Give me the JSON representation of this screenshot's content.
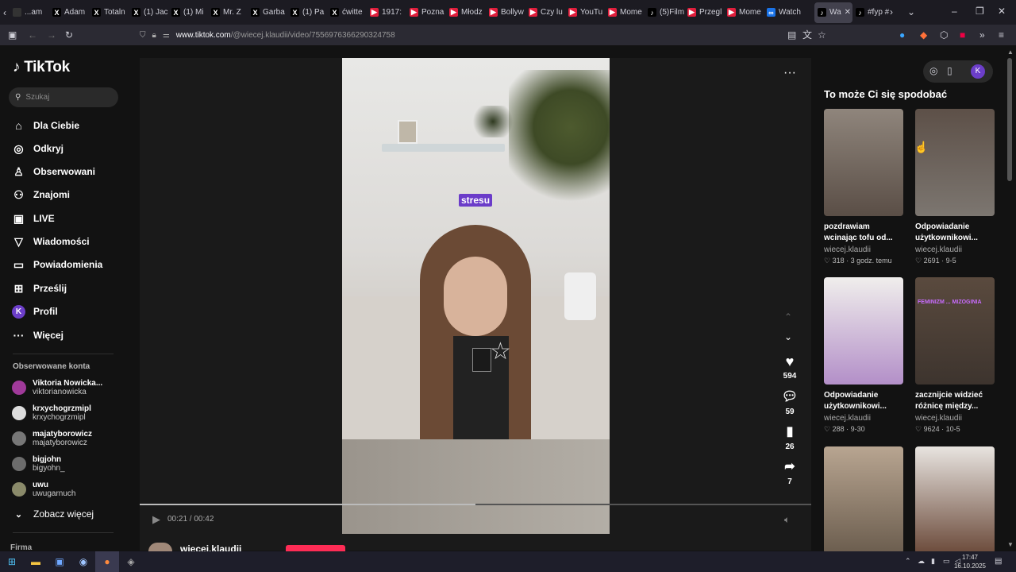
{
  "browser": {
    "tabs": [
      {
        "label": "...am",
        "color": "#333"
      },
      {
        "label": "Adam",
        "icon": "X",
        "color": "#000"
      },
      {
        "label": "Totaln",
        "icon": "X",
        "color": "#000"
      },
      {
        "label": "(1) Jac",
        "icon": "X",
        "color": "#000"
      },
      {
        "label": "(1) Mi",
        "icon": "X",
        "color": "#000"
      },
      {
        "label": "Mr. Z",
        "icon": "X",
        "color": "#000"
      },
      {
        "label": "Garba",
        "icon": "X",
        "color": "#000"
      },
      {
        "label": "(1) Pa",
        "icon": "X",
        "color": "#000"
      },
      {
        "label": "ćwitte",
        "icon": "X",
        "color": "#000"
      },
      {
        "label": "1917:",
        "icon": "▶",
        "color": "#e01e3c"
      },
      {
        "label": "Pozna",
        "icon": "▶",
        "color": "#e01e3c"
      },
      {
        "label": "Młodz",
        "icon": "▶",
        "color": "#e01e3c"
      },
      {
        "label": "Bollyw",
        "icon": "▶",
        "color": "#e01e3c"
      },
      {
        "label": "Czy lu",
        "icon": "▶",
        "color": "#e01e3c"
      },
      {
        "label": "YouTu",
        "icon": "▶",
        "color": "#e01e3c"
      },
      {
        "label": "Mome",
        "icon": "▶",
        "color": "#e01e3c"
      },
      {
        "label": "(5)Film",
        "icon": "♪",
        "color": "#000"
      },
      {
        "label": "Przegl",
        "icon": "▶",
        "color": "#e01e3c"
      },
      {
        "label": "Mome",
        "icon": "▶",
        "color": "#e01e3c"
      },
      {
        "label": "Watch",
        "icon": "∞",
        "color": "#1a73e8"
      },
      {
        "label": "Wa",
        "icon": "♪",
        "color": "#000",
        "active": true
      },
      {
        "label": "#fyp #",
        "icon": "♪",
        "color": "#000"
      }
    ],
    "url_host": "www.tiktok.com",
    "url_path": "/@wiecej.klaudii/video/7556976366290324758"
  },
  "sidebar": {
    "logo": "TikTok",
    "search_placeholder": "Szukaj",
    "nav": [
      {
        "label": "Dla Ciebie",
        "icon": "⌂"
      },
      {
        "label": "Odkryj",
        "icon": "◎"
      },
      {
        "label": "Obserwowani",
        "icon": "♙"
      },
      {
        "label": "Znajomi",
        "icon": "⚇"
      },
      {
        "label": "LIVE",
        "icon": "▣"
      },
      {
        "label": "Wiadomości",
        "icon": "▽"
      },
      {
        "label": "Powiadomienia",
        "icon": "▭"
      },
      {
        "label": "Prześlij",
        "icon": "⊞"
      },
      {
        "label": "Profil",
        "icon": "K"
      },
      {
        "label": "Więcej",
        "icon": "···"
      }
    ],
    "followed_title": "Obserwowane konta",
    "accounts": [
      {
        "name": "Viktoria Nowicka...",
        "handle": "viktorianowicka"
      },
      {
        "name": "krxychogrzmipl",
        "handle": "krxychogrzmipl"
      },
      {
        "name": "majatyborowicz",
        "handle": "majatyborowicz"
      },
      {
        "name": "bigjohn",
        "handle": "bigyohn_"
      },
      {
        "name": "uwu",
        "handle": "uwugarnuch"
      }
    ],
    "see_more": "Zobacz więcej",
    "footer": "Firma"
  },
  "video": {
    "caption": "stresu",
    "time": "00:21 / 00:42",
    "likes": "594",
    "comments": "59",
    "saves": "26",
    "shares": "7",
    "author": "wiecej.klaudii",
    "progress": 0.5
  },
  "recommendations": {
    "title": "To może Ci się spodobać",
    "items": [
      {
        "title": "pozdrawiam",
        "title2": "wcinając tofu od...",
        "author": "wiecej.klaudii",
        "likes": "318",
        "date": "3 godz. temu"
      },
      {
        "title": "Odpowiadanie",
        "title2": "użytkownikowi...",
        "author": "wiecej.klaudii",
        "likes": "2691",
        "date": "9-5"
      },
      {
        "title": "Odpowiadanie",
        "title2": "użytkownikowi...",
        "author": "wiecej.klaudii",
        "likes": "288",
        "date": "9-30"
      },
      {
        "title": "zacznijcie widzieć",
        "title2": "różnicę między...",
        "author": "wiecej.klaudii",
        "likes": "9624",
        "date": "10-5"
      },
      {
        "title": "",
        "title2": "",
        "author": "",
        "likes": "",
        "date": ""
      },
      {
        "title": "",
        "title2": "",
        "author": "",
        "likes": "",
        "date": ""
      }
    ],
    "overlay_text": "FEMINIZM ... MIZOGINIA"
  },
  "taskbar": {
    "time": "17:47",
    "date": "16.10.2025"
  }
}
